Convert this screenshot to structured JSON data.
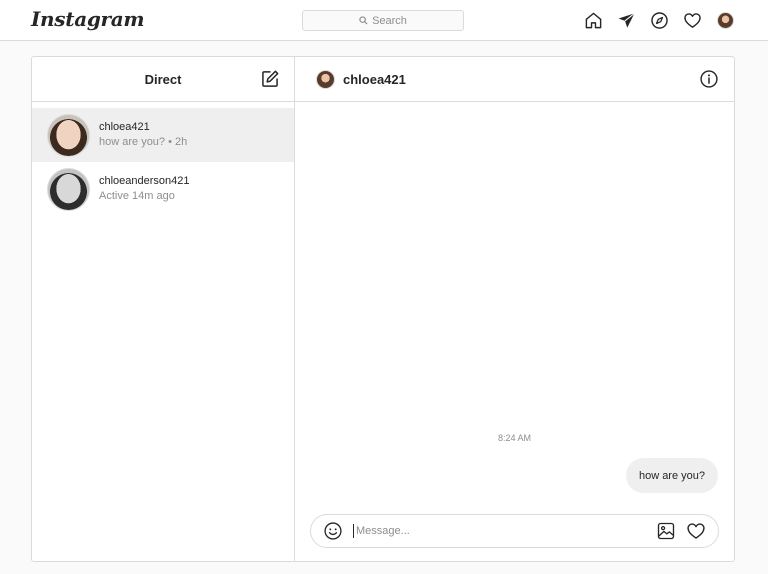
{
  "nav": {
    "logo": "Instagram",
    "search_placeholder": "Search",
    "icons": [
      "home-icon",
      "direct-icon",
      "explore-icon",
      "activity-heart-icon",
      "profile-avatar"
    ]
  },
  "inbox": {
    "title": "Direct",
    "threads": [
      {
        "name": "chloea421",
        "subtitle": "how are you? • 2h",
        "active": true
      },
      {
        "name": "chloeanderson421",
        "subtitle": "Active 14m ago",
        "active": false
      }
    ]
  },
  "chat": {
    "username": "chloea421",
    "timestamp": "8:24 AM",
    "messages": [
      {
        "text": "how are you?",
        "from": "me"
      }
    ],
    "composer_placeholder": "Message..."
  },
  "colors": {
    "text": "#262626",
    "muted": "#8e8e8e",
    "border": "#dbdbdb",
    "active_row": "#efefef",
    "bubble": "#efefef"
  }
}
